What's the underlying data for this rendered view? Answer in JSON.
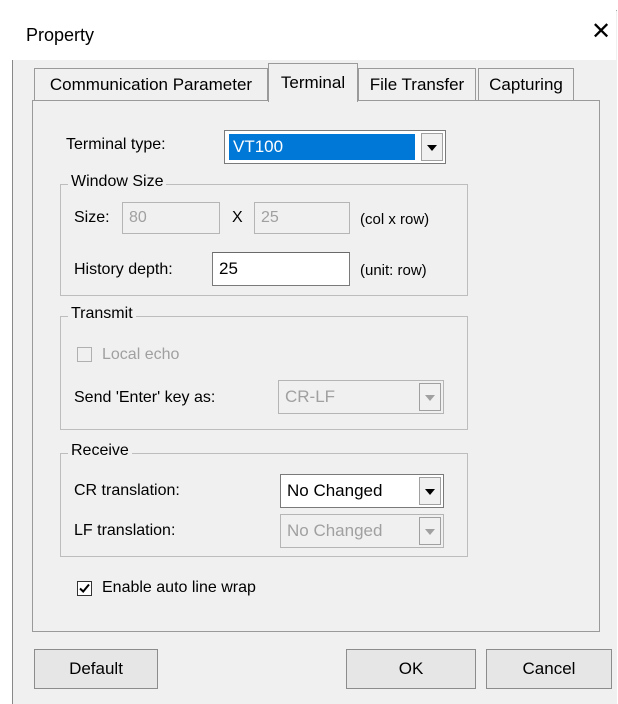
{
  "window": {
    "title": "Property",
    "close_glyph": "✕"
  },
  "tabs": [
    {
      "label": "Communication Parameter",
      "active": false
    },
    {
      "label": "Terminal",
      "active": true
    },
    {
      "label": "File Transfer",
      "active": false
    },
    {
      "label": "Capturing",
      "active": false
    }
  ],
  "terminal_type": {
    "label": "Terminal type:",
    "value": "VT100"
  },
  "window_size": {
    "group_title": "Window Size",
    "size_label": "Size:",
    "cols": "80",
    "separator": "X",
    "rows": "25",
    "size_unit": "(col x row)",
    "history_label": "History depth:",
    "history_value": "25",
    "history_unit": "(unit: row)"
  },
  "transmit": {
    "group_title": "Transmit",
    "local_echo_label": "Local echo",
    "local_echo_checked": false,
    "send_enter_label": "Send 'Enter' key  as:",
    "send_enter_value": "CR-LF"
  },
  "receive": {
    "group_title": "Receive",
    "cr_label": "CR translation:",
    "cr_value": "No Changed",
    "lf_label": "LF translation:",
    "lf_value": "No Changed"
  },
  "auto_wrap": {
    "label": "Enable auto line wrap",
    "checked": true
  },
  "buttons": {
    "default": "Default",
    "ok": "OK",
    "cancel": "Cancel"
  },
  "icons": {
    "dropdown": "chevron-down-icon",
    "check": "check-icon"
  },
  "colors": {
    "selection": "#0078d7",
    "panel": "#f0f0f0"
  }
}
